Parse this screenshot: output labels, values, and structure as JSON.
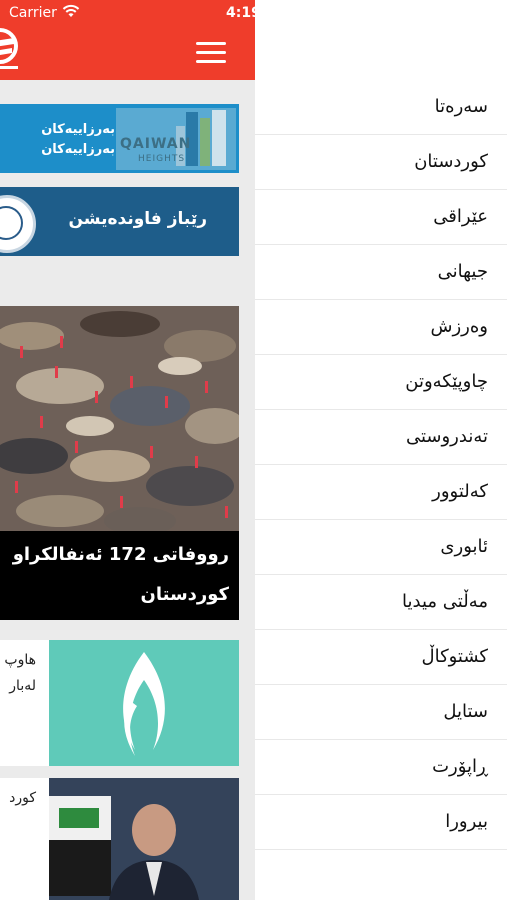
{
  "status_bar": {
    "carrier": "Carrier",
    "time": "4:19"
  },
  "ads": [
    {
      "line1": "بەرزاییەکان",
      "line2": "بەرزاییەکان",
      "brand": "QAIWAN",
      "brand_sub": "HEIGHTS"
    },
    {
      "name": "رێباز فاوندەیشن"
    }
  ],
  "stories": [
    {
      "title_line1": "رووفاتی 172 ئەنفالکراو",
      "title_line2": "کوردستان"
    },
    {
      "snippet_line1": "هاوپ",
      "snippet_line2": "لەبار"
    },
    {
      "snippet_line1": "کورد"
    }
  ],
  "menu": {
    "items": [
      "سەرەتا",
      "کوردستان",
      "عێراقی",
      "جیهانی",
      "وەرزش",
      "چاوپێکەوتن",
      "تەندروستی",
      "کەلتوور",
      "ئابوری",
      "مەڵتی میدیا",
      "کشتوکاڵ",
      "ستایل",
      "ڕاپۆرت",
      "بیرورا"
    ]
  },
  "colors": {
    "header": "#ef3d2b",
    "ad1": "#1d8ec9",
    "ad2": "#1e5d8a",
    "teal": "#5fcab9"
  }
}
